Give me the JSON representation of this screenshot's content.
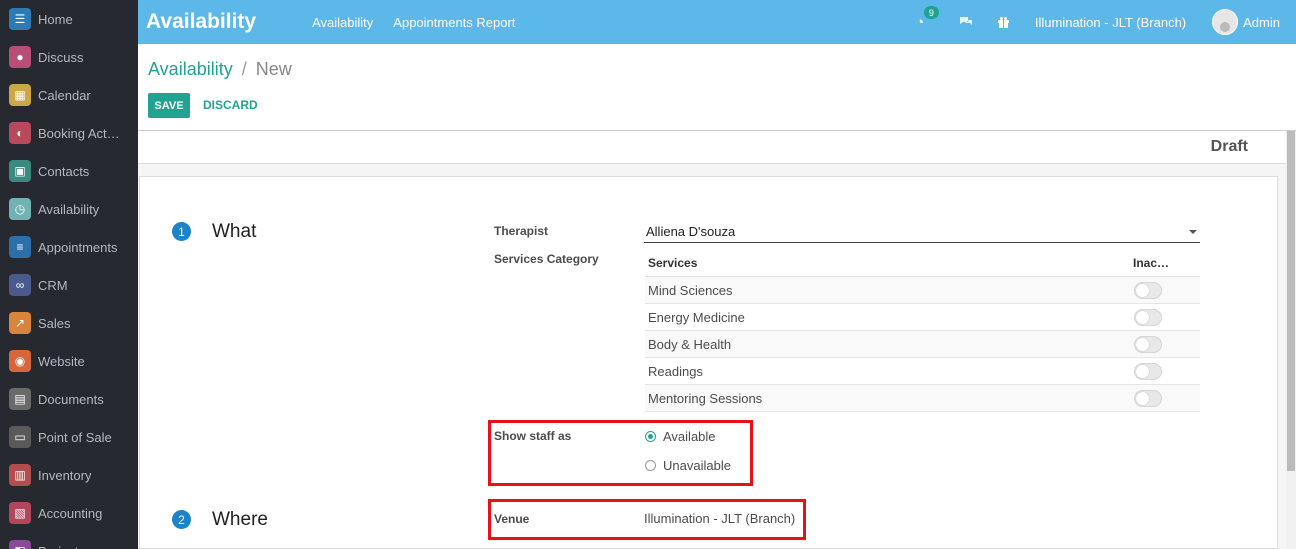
{
  "sidebar": {
    "items": [
      {
        "label": "Home",
        "icon": "home-icon",
        "color": "#2b7bb9",
        "glyph": "☰"
      },
      {
        "label": "Discuss",
        "icon": "discuss-icon",
        "color": "#b84e77",
        "glyph": "●"
      },
      {
        "label": "Calendar",
        "icon": "calendar-icon",
        "color": "#c9a845",
        "glyph": "▦"
      },
      {
        "label": "Booking Act…",
        "icon": "booking-icon",
        "color": "#b64a5c",
        "glyph": "◐"
      },
      {
        "label": "Contacts",
        "icon": "contacts-icon",
        "color": "#3a8a80",
        "glyph": "▣"
      },
      {
        "label": "Availability",
        "icon": "availability-icon",
        "color": "#6fb3b3",
        "glyph": "◷"
      },
      {
        "label": "Appointments",
        "icon": "appointments-icon",
        "color": "#2d6fa8",
        "glyph": "≡"
      },
      {
        "label": "CRM",
        "icon": "crm-icon",
        "color": "#4a5a8c",
        "glyph": "∞"
      },
      {
        "label": "Sales",
        "icon": "sales-icon",
        "color": "#d8843a",
        "glyph": "↗"
      },
      {
        "label": "Website",
        "icon": "website-icon",
        "color": "#d7663a",
        "glyph": "◉"
      },
      {
        "label": "Documents",
        "icon": "documents-icon",
        "color": "#6a6a6a",
        "glyph": "▤"
      },
      {
        "label": "Point of Sale",
        "icon": "pos-icon",
        "color": "#5a5a5a",
        "glyph": "▭"
      },
      {
        "label": "Inventory",
        "icon": "inventory-icon",
        "color": "#b24e4e",
        "glyph": "▥"
      },
      {
        "label": "Accounting",
        "icon": "accounting-icon",
        "color": "#b2475c",
        "glyph": "▧"
      },
      {
        "label": "Project",
        "icon": "project-icon",
        "color": "#8a4a9a",
        "glyph": "◧"
      }
    ]
  },
  "topbar": {
    "app_title": "Availability",
    "menus": [
      "Availability",
      "Appointments Report"
    ],
    "activity_count": "9",
    "company": "Illumination - JLT (Branch)",
    "user": "Admin"
  },
  "breadcrumb": {
    "parent": "Availability",
    "separator": "/",
    "current": "New"
  },
  "actions": {
    "save": "SAVE",
    "discard": "DISCARD"
  },
  "status": "Draft",
  "form": {
    "section1": {
      "number": "1",
      "title": "What"
    },
    "section2": {
      "number": "2",
      "title": "Where"
    },
    "therapist_label": "Therapist",
    "therapist_value": "Alliena D'souza",
    "services_category_label": "Services Category",
    "services_table": {
      "headers": [
        "Services",
        "Inac…"
      ],
      "rows": [
        "Mind Sciences",
        "Energy Medicine",
        "Body & Health",
        "Readings",
        "Mentoring Sessions"
      ]
    },
    "show_staff_label": "Show staff as",
    "show_staff_options": [
      "Available",
      "Unavailable"
    ],
    "show_staff_selected": "Available",
    "venue_label": "Venue",
    "venue_value": "Illumination - JLT (Branch)"
  },
  "colors": {
    "brand": "#21a391",
    "topbar": "#5cb8e8",
    "sidebar": "#262a30",
    "highlight": "#e8111a",
    "step": "#1d82c8"
  }
}
